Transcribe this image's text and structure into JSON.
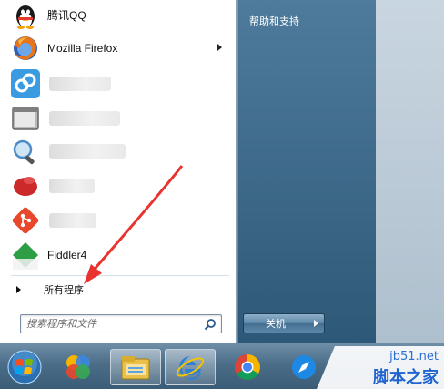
{
  "start_menu": {
    "programs": [
      {
        "label": "腾讯QQ",
        "icon": "qq-penguin-icon"
      },
      {
        "label": "Mozilla Firefox",
        "icon": "firefox-icon",
        "has_submenu": true
      },
      {
        "label": "",
        "icon": "blue-app-icon",
        "blurred": true
      },
      {
        "label": "",
        "icon": "window-app-icon",
        "blurred": true
      },
      {
        "label": "",
        "icon": "magnifier-app-icon",
        "blurred": true
      },
      {
        "label": "",
        "icon": "red-app-icon",
        "blurred": true
      },
      {
        "label": "",
        "icon": "git-icon",
        "blurred": true
      },
      {
        "label": "Fiddler4",
        "icon": "fiddler-icon"
      }
    ],
    "all_programs_label": "所有程序",
    "search_placeholder": "搜索程序和文件"
  },
  "right_panel": {
    "help_support_label": "帮助和支持",
    "shutdown_label": "关机"
  },
  "taskbar": {
    "items": [
      "start-orb-icon",
      "media-app-icon",
      "file-explorer-icon",
      "internet-explorer-icon",
      "chrome-icon",
      "browser-compass-icon"
    ]
  },
  "watermark": {
    "url": "jb51.net",
    "site_name": "脚本之家"
  },
  "colors": {
    "annotation_arrow": "#e8332e",
    "right_panel": "#3d6888"
  }
}
